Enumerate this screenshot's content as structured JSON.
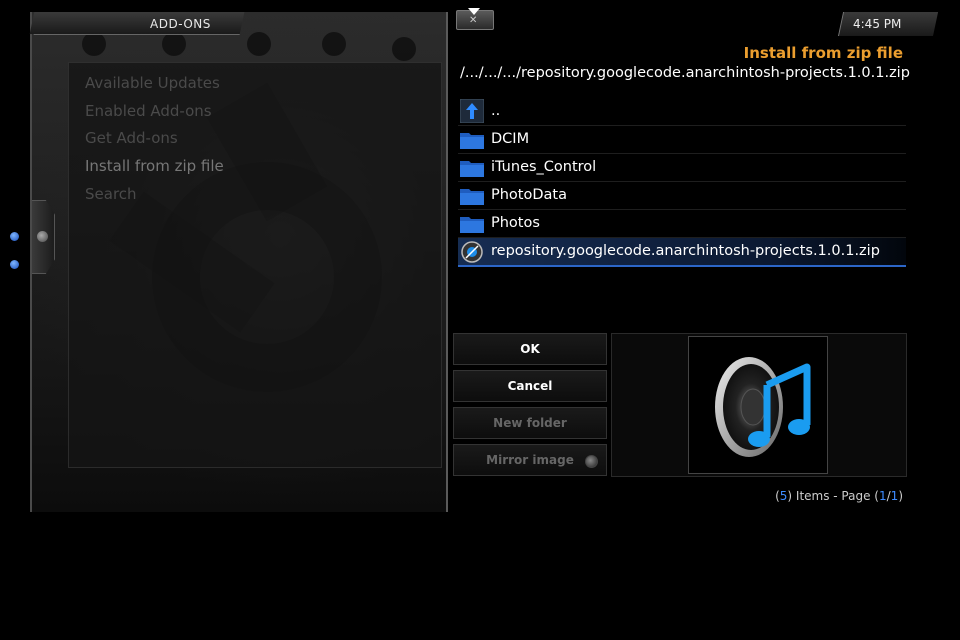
{
  "left_panel": {
    "title": "ADD-ONS",
    "menu": [
      {
        "label": "Available Updates"
      },
      {
        "label": "Enabled Add-ons"
      },
      {
        "label": "Get Add-ons"
      },
      {
        "label": "Install from zip file"
      },
      {
        "label": "Search"
      }
    ]
  },
  "clock": "4:45 PM",
  "dialog": {
    "heading": "Install from zip file",
    "path": "/.../.../.../repository.googlecode.anarchintosh-projects.1.0.1.zip",
    "files": [
      {
        "label": "..",
        "icon": "parent-folder-icon"
      },
      {
        "label": "DCIM",
        "icon": "folder-icon"
      },
      {
        "label": "iTunes_Control",
        "icon": "folder-icon"
      },
      {
        "label": "PhotoData",
        "icon": "folder-icon"
      },
      {
        "label": "Photos",
        "icon": "folder-icon"
      },
      {
        "label": "repository.googlecode.anarchintosh-projects.1.0.1.zip",
        "icon": "zip-file-icon"
      }
    ],
    "buttons": {
      "ok": "OK",
      "cancel": "Cancel",
      "new_folder": "New folder",
      "mirror_image": "Mirror image"
    },
    "item_count": {
      "count": "5",
      "items_text": "Items - Page",
      "page": "1",
      "pages": "1"
    }
  },
  "colors": {
    "heading": "#eb9e2f",
    "selection": "#2c66c8",
    "count_highlight": "#3d8bff"
  }
}
